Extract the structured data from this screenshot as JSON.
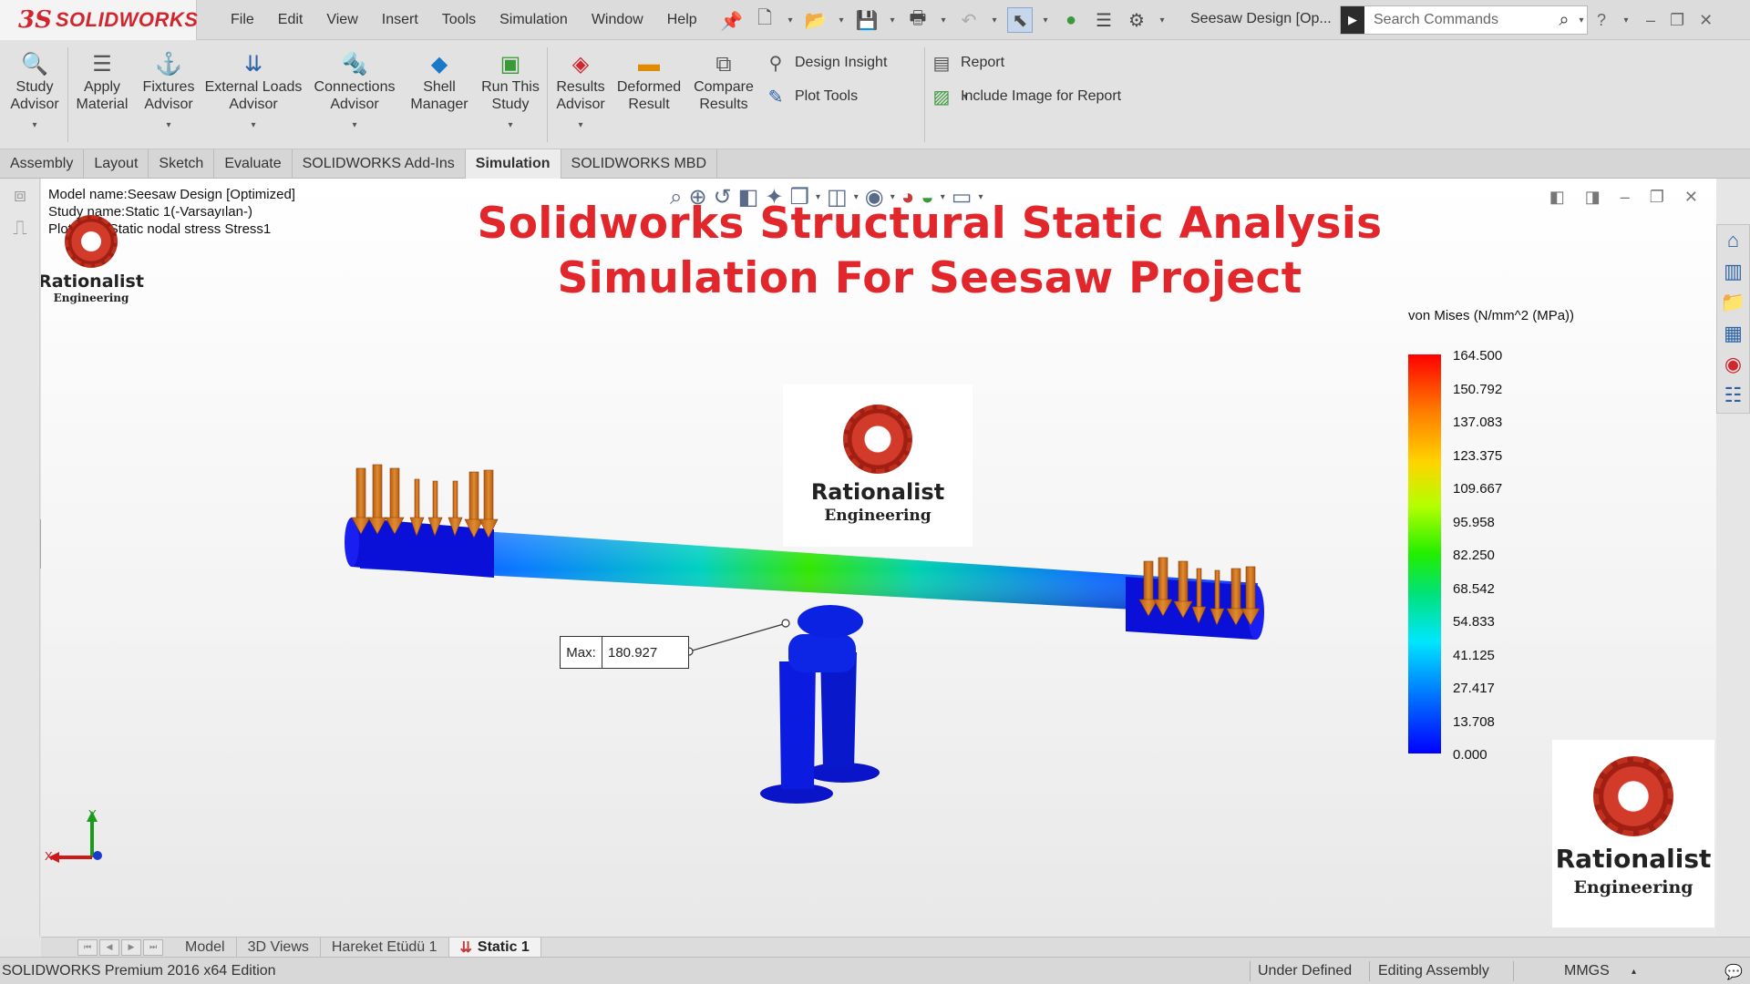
{
  "app": {
    "logo_ds": "3S",
    "logo_text": "SOLIDWORKS"
  },
  "menu": [
    "File",
    "Edit",
    "View",
    "Insert",
    "Tools",
    "Simulation",
    "Window",
    "Help"
  ],
  "title": "Seesaw Design [Op...",
  "search": {
    "placeholder": "Search Commands"
  },
  "toolbar": {
    "study_advisor": "Study Advisor",
    "apply_material": "Apply Material",
    "fixtures_advisor": "Fixtures Advisor",
    "external_loads_advisor": "External Loads Advisor",
    "connections_advisor": "Connections Advisor",
    "shell_manager": "Shell Manager",
    "run_this_study": "Run This Study",
    "results_advisor": "Results Advisor",
    "deformed_result": "Deformed Result",
    "compare_results": "Compare Results",
    "design_insight": "Design Insight",
    "plot_tools": "Plot Tools",
    "report": "Report",
    "include_image": "Include Image for Report"
  },
  "tabs": [
    {
      "label": "Assembly",
      "active": false
    },
    {
      "label": "Layout",
      "active": false
    },
    {
      "label": "Sketch",
      "active": false
    },
    {
      "label": "Evaluate",
      "active": false
    },
    {
      "label": "SOLIDWORKS Add-Ins",
      "active": false
    },
    {
      "label": "Simulation",
      "active": true
    },
    {
      "label": "SOLIDWORKS MBD",
      "active": false
    }
  ],
  "viewport": {
    "model_name": "Model name:Seesaw Design [Optimized]",
    "study_name": "Study name:Static 1(-Varsayılan-)",
    "plot_type": "Plot type: Static nodal stress Stress1",
    "heading_line1": "Solidworks Structural Static Analysis",
    "heading_line2": "Simulation For Seesaw Project",
    "brand_name": "Rationalist",
    "brand_sub": "Engineering",
    "max_label": "Max:",
    "max_value": "180.927",
    "triad_x": "X",
    "triad_y": "Y"
  },
  "legend": {
    "title": "von Mises (N/mm^2 (MPa))",
    "ticks": [
      "164.500",
      "150.792",
      "137.083",
      "123.375",
      "109.667",
      "95.958",
      "82.250",
      "68.542",
      "54.833",
      "41.125",
      "27.417",
      "13.708",
      "0.000"
    ],
    "colors": {
      "high": "#ff0000",
      "mid": "#22ee00",
      "low": "#0000ff"
    }
  },
  "model_tabs": [
    {
      "label": "Model",
      "active": false
    },
    {
      "label": "3D Views",
      "active": false
    },
    {
      "label": "Hareket Etüdü 1",
      "active": false
    },
    {
      "label": "Static 1",
      "active": true
    }
  ],
  "status": {
    "edition": "SOLIDWORKS Premium 2016 x64 Edition",
    "defined": "Under Defined",
    "mode": "Editing Assembly",
    "units": "MMGS"
  },
  "colors": {
    "brand_red": "#d2262e",
    "heading_red": "#e1272c",
    "accent_blue": "#2d62a8"
  }
}
